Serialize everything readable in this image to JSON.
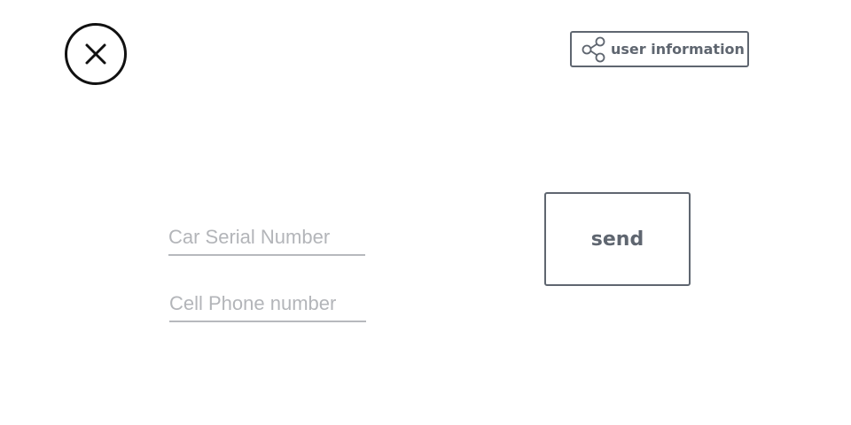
{
  "header": {
    "close_icon": "close-icon",
    "share_icon": "share-icon",
    "share_label": "user information"
  },
  "form": {
    "serial_field": {
      "placeholder": "Car Serial Number",
      "value": ""
    },
    "phone_field": {
      "placeholder": "Cell Phone number",
      "value": ""
    },
    "send_label": "send"
  },
  "colors": {
    "close_border": "#111111",
    "button_border": "#5f6670",
    "button_text": "#5f6670",
    "placeholder_text": "#b3b5b9",
    "field_underline": "#b7b9bd",
    "background": "#ffffff"
  }
}
